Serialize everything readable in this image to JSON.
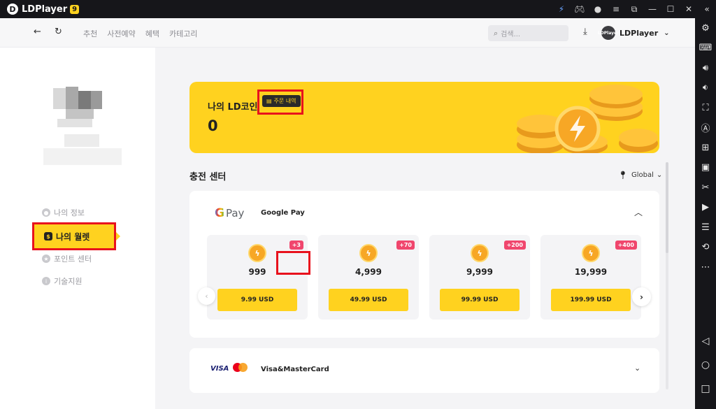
{
  "titlebar": {
    "app_name": "LDPlayer",
    "badge": "9",
    "icons": [
      "lightning-icon",
      "gamepad-icon",
      "account-icon",
      "menu-icon",
      "external-icon",
      "collapse-icon",
      "minimize-icon",
      "maximize-icon",
      "close-icon"
    ]
  },
  "header": {
    "nav": [
      "추천",
      "사전예약",
      "혜택",
      "카테고리"
    ],
    "search_placeholder": "검색...",
    "user_name": "LDPlayer",
    "avatar_text": "LDPlayer"
  },
  "sidebar": {
    "items": [
      {
        "label": "나의 정보",
        "icon": "person-icon"
      },
      {
        "label": "나의 월렛",
        "icon": "wallet-icon",
        "active": true
      },
      {
        "label": "포인트 센터",
        "icon": "star-icon"
      },
      {
        "label": "기술지원",
        "icon": "info-icon"
      }
    ]
  },
  "coin": {
    "title": "나의 LD코인",
    "order_history": "주문 내역",
    "balance": "0"
  },
  "recharge": {
    "title": "충전 센터",
    "region": "Global",
    "google_pay": {
      "logo_g": "G",
      "logo_text": "Pay",
      "name": "Google Pay",
      "packages": [
        {
          "amount": "999",
          "price": "9.99 USD",
          "bonus": "+3"
        },
        {
          "amount": "4,999",
          "price": "49.99 USD",
          "bonus": "+70"
        },
        {
          "amount": "9,999",
          "price": "99.99 USD",
          "bonus": "+200"
        },
        {
          "amount": "19,999",
          "price": "199.99 USD",
          "bonus": "+400"
        }
      ]
    },
    "card": {
      "visa": "VISA",
      "name": "Visa&MasterCard"
    }
  },
  "colors": {
    "accent": "#ffd21f",
    "badge": "#f0466d",
    "highlight_box": "#e8121d"
  }
}
